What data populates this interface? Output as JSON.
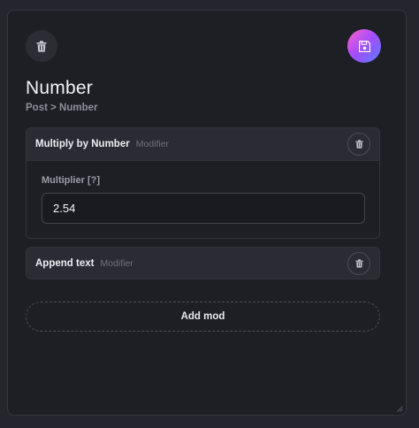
{
  "header": {
    "title": "Number",
    "breadcrumb": "Post > Number",
    "delete_icon": "trash-icon",
    "save_icon": "floppy-disk-icon"
  },
  "mods": [
    {
      "name": "Multiply by Number",
      "type": "Modifier",
      "field": {
        "label": "Multiplier [?]",
        "value": "2.54"
      }
    },
    {
      "name": "Append text",
      "type": "Modifier"
    }
  ],
  "add_mod_label": "Add mod",
  "colors": {
    "background": "#1e1f25",
    "card_header": "#2b2c33",
    "save_gradient_start": "#ff5fc8",
    "save_gradient_end": "#5a7dff"
  }
}
